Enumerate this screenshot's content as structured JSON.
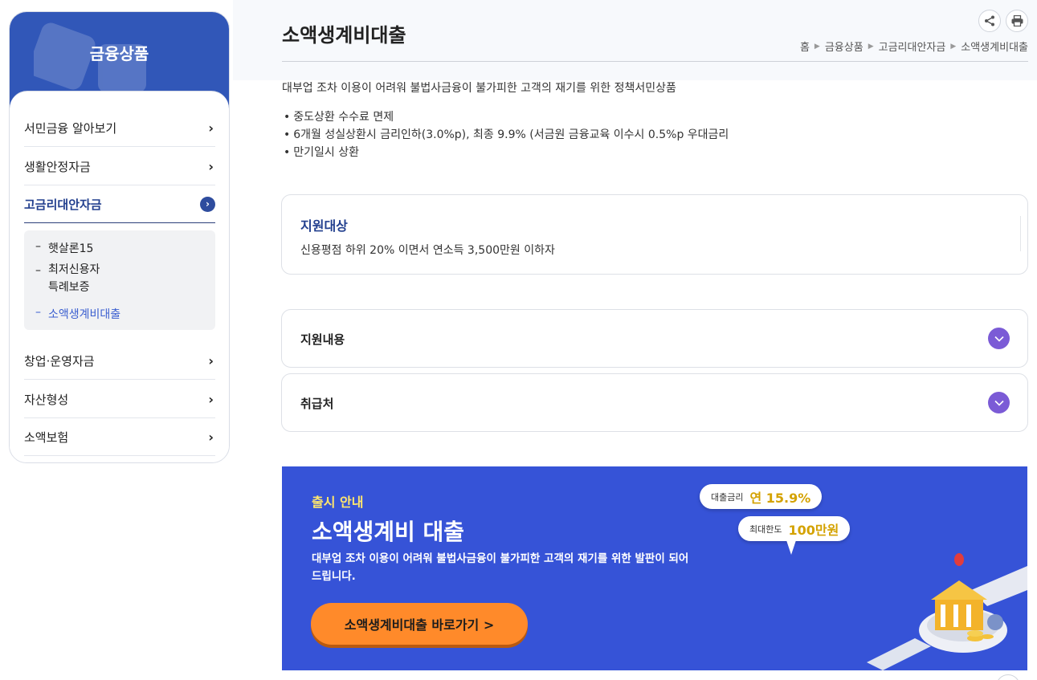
{
  "sidebar": {
    "title": "금융상품",
    "items": [
      {
        "label": "서민금융 알아보기"
      },
      {
        "label": "생활안정자금"
      },
      {
        "label": "고금리대안자금"
      },
      {
        "label": "창업·운영자금"
      },
      {
        "label": "자산형성"
      },
      {
        "label": "소액보험"
      }
    ],
    "submenu": [
      {
        "label": "햇살론15"
      },
      {
        "label": "최저신용자",
        "label2": "특례보증"
      },
      {
        "label": "소액생계비대출"
      }
    ]
  },
  "header": {
    "title": "소액생계비대출",
    "breadcrumb": [
      "홈",
      "금융상품",
      "고금리대안자금",
      "소액생계비대출"
    ]
  },
  "intro": "대부업 조차 이용이 어려워 불법사금융이 불가피한 고객의 재기를 위한 정책서민상품",
  "bullets": [
    "중도상환 수수료 면제",
    "6개월 성실상환시 금리인하(3.0%p), 최종 9.9% (서금원 금융교육 이수시 0.5%p 우대금리",
    "만기일시 상환"
  ],
  "target": {
    "heading": "지원대상",
    "text": "신용평점 하위 20% 이면서 연소득 3,500만원 이하자"
  },
  "accordions": [
    {
      "label": "지원내용"
    },
    {
      "label": "취급처"
    }
  ],
  "banner": {
    "label": "출시 안내",
    "title": "소액생계비 대출",
    "desc": "대부업 조차 이용이 어려워 불법사금융이 불가피한 고객의 재기를 위한 발판이 되어드립니다.",
    "button": "소액생계비대출 바로가기 >",
    "rate_label": "대출금리",
    "rate_value": "연 15.9%",
    "limit_label": "최대한도",
    "limit_value": "100만원"
  },
  "colors": {
    "sidebar_header": "#3157b8",
    "active_menu": "#23408f",
    "accordion_toggle": "#7b5bd6",
    "banner_bg": "#3653d7",
    "banner_button": "#ff8a2a",
    "banner_label": "#ffe66d"
  },
  "icons": {
    "share": "share-icon",
    "print": "print-icon",
    "menu_chevron": "chevron-right-icon",
    "accordion": "chevron-down-icon"
  }
}
